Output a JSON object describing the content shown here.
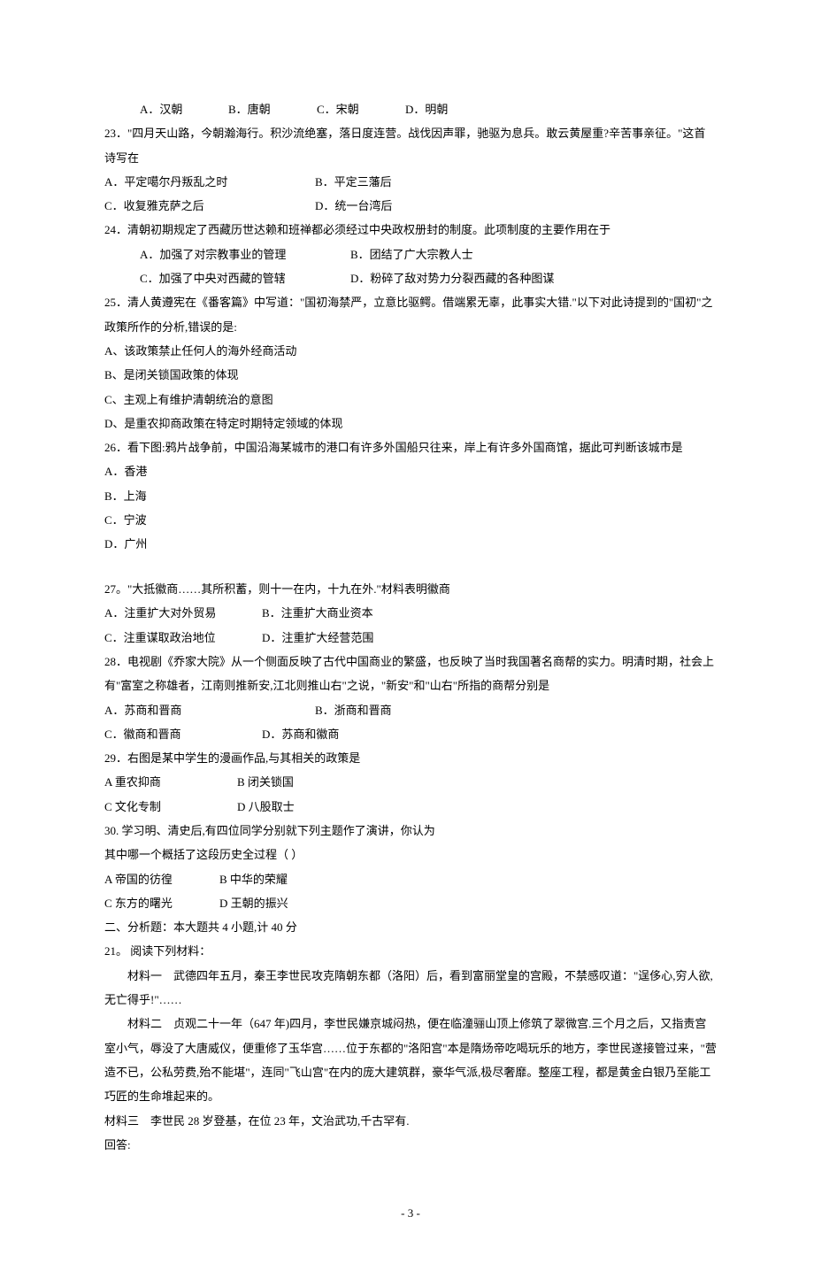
{
  "q22_opts": {
    "indent": true,
    "a": "A．汉朝",
    "b": "B．唐朝",
    "c": "C．宋朝",
    "d": "D．明朝"
  },
  "q23": {
    "stem": "23．\"四月天山路，今朝瀚海行。积沙流绝塞，落日度连营。战伐因声罪，驰驱为息兵。敢云黄屋重?辛苦事亲征。\"这首诗写在",
    "r1a": "A．平定噶尔丹叛乱之时",
    "r1b": "B．平定三藩后",
    "r2a": "C．收复雅克萨之后",
    "r2b": "D．统一台湾后"
  },
  "q24": {
    "stem": "24．清朝初期规定了西藏历世达赖和班禅都必须经过中央政权册封的制度。此项制度的主要作用在于",
    "r1a": "A．加强了对宗教事业的管理",
    "r1b": "B．团结了广大宗教人士",
    "r2a": "C．加强了中央对西藏的管辖",
    "r2b": "D．粉碎了敌对势力分裂西藏的各种图谋"
  },
  "q25": {
    "stem": "25．清人黄遵宪在《番客篇》中写道：\"国初海禁严，立意比驱鳄。借端累无辜，此事实大错.\"以下对此诗提到的\"国初\"之政策所作的分析,错误的是:",
    "a": "A、该政策禁止任何人的海外经商活动",
    "b": " B、是闭关锁国政策的体现",
    "c": "C、主观上有维护清朝统治的意图",
    "d": " D、是重农抑商政策在特定时期特定领域的体现"
  },
  "q26": {
    "stem": "26．看下图:鸦片战争前，中国沿海某城市的港口有许多外国船只往来，岸上有许多外国商馆，据此可判断该城市是",
    "a": "A．香港",
    "b": "B．上海",
    "c": "C．宁波",
    "d": "D．广州"
  },
  "q27": {
    "stem": "27。\"大抵徽商……其所积蓄，则十一在内，十九在外.\"材料表明徽商",
    "r1a": "A．注重扩大对外贸易",
    "r1b": "B．注重扩大商业资本",
    "r2a": "C．注重谋取政治地位",
    "r2b": "D．注重扩大经营范围"
  },
  "q28": {
    "stem": "28．电视剧《乔家大院》从一个侧面反映了古代中国商业的繁盛，也反映了当时我国著名商帮的实力。明清时期，社会上有\"富室之称雄者，江南则推新安,江北则推山右\"之说，\"新安\"和\"山右\"所指的商帮分别是",
    "r1a": "A．苏商和晋商",
    "r1b": "B．浙商和晋商",
    "r2a": "C．徽商和晋商",
    "r2b": "D．苏商和徽商"
  },
  "q29": {
    "stem": "29．右图是某中学生的漫画作品,与其相关的政策是",
    "r1a": "A 重农抑商",
    "r1b": "B 闭关锁国",
    "r2a": " C 文化专制",
    "r2b": "D 八股取士"
  },
  "q30": {
    "stem1": "30. 学习明、清史后,有四位同学分别就下列主题作了演讲，你认为",
    "stem2": "其中哪一个概括了这段历史全过程（ ）",
    "r1a": "A 帝国的彷徨",
    "r1b": "B 中华的荣耀",
    "r2a": "C 东方的曙光",
    "r2b": "D 王朝的振兴"
  },
  "section2": "二、分析题：本大题共 4 小题,计 40 分",
  "q21": {
    "num": "21。 阅读下列材料：",
    "m1": "材料一　武德四年五月，秦王李世民攻克隋朝东都（洛阳）后，看到富丽堂皇的宫殿，不禁感叹道：\"逞侈心,穷人欲,无亡得乎!\"……",
    "m2": "材料二　贞观二十一年（647 年)四月，李世民嫌京城闷热，便在临潼骊山顶上修筑了翠微宫.三个月之后，又指责宫室小气，辱没了大唐威仪，便重修了玉华宫……位于东都的\"洛阳宫\"本是隋炀帝吃喝玩乐的地方，李世民遂接管过来，\"营造不已，公私劳费,殆不能堪\"，连同\"飞山宫\"在内的庞大建筑群，豪华气派,极尽奢靡。整座工程，都是黄金白银乃至能工巧匠的生命堆起来的。",
    "m3": "材料三　李世民 28 岁登基，在位 23 年，文治武功,千古罕有.",
    "hd": "回答:"
  },
  "footer": "- 3 -"
}
